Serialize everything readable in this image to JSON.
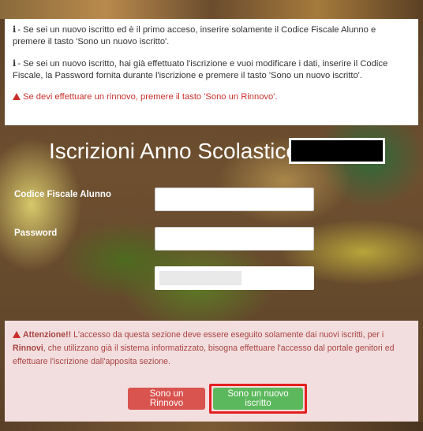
{
  "info": {
    "line1": "- Se sei un nuovo iscritto ed è il primo acceso, inserire solamente il Codice Fiscale Alunno e premere il tasto 'Sono un nuovo iscritto'.",
    "line2": "- Se sei un nuovo iscritto, hai già effettuato l'iscrizione e vuoi modificare i dati, inserire il Codice Fiscale, la Password fornita durante l'iscrizione e premere il tasto 'Sono un nuovo iscritto'.",
    "warning": "Se devi effettuare un rinnovo, premere il tasto 'Sono un Rinnovo'.",
    "info_icon": "i"
  },
  "form": {
    "title": "Iscrizioni Anno Scolastico",
    "codice_label": "Codice Fiscale Alunno",
    "codice_value": "",
    "password_label": "Password",
    "password_value": ""
  },
  "notice": {
    "attention": "Attenzione!!",
    "text_a": " L'accesso da questa sezione deve essere eseguito solamente dai nuovi iscritti, per i ",
    "rinnovi": "Rinnovi",
    "text_b": ", che utilizzano già il sistema informatizzato, bisogna effettuare l'accesso dal portale genitori ed effettuare l'iscrizione dall'apposita sezione."
  },
  "buttons": {
    "rinnovo": "Sono un Rinnovo",
    "nuovo": "Sono un nuovo iscritto"
  },
  "colors": {
    "danger": "#d9534f",
    "success": "#5cb85c",
    "highlight": "#e32020",
    "alert_bg": "#f2dede"
  }
}
